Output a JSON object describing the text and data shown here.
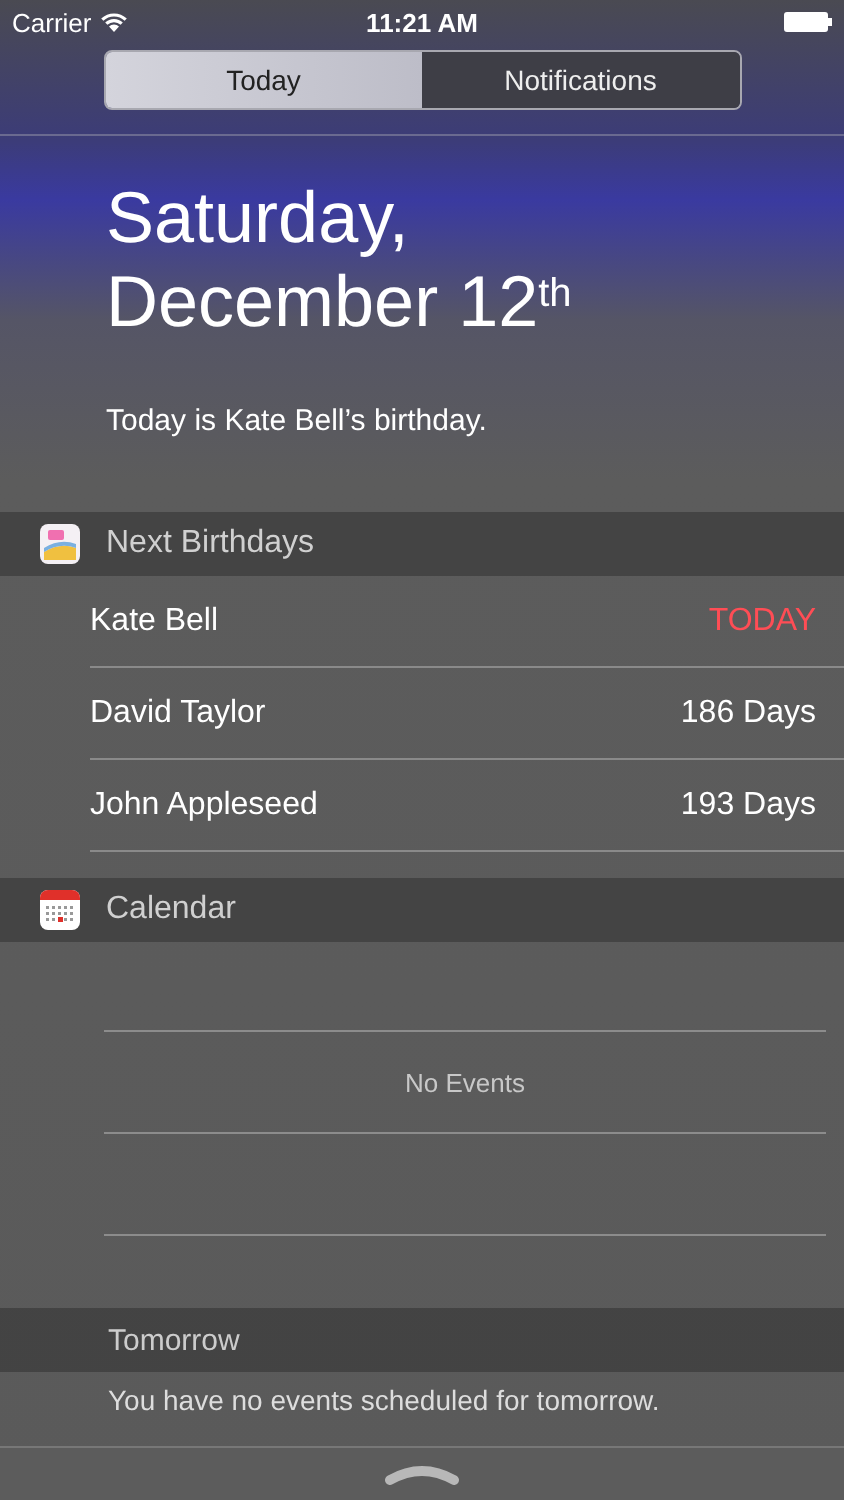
{
  "status_bar": {
    "carrier": "Carrier",
    "time": "11:21 AM"
  },
  "tabs": [
    {
      "label": "Today",
      "selected": true
    },
    {
      "label": "Notifications",
      "selected": false
    }
  ],
  "date": {
    "line_1": "Saturday,",
    "line_2": "December 12$^{th}$"
  },
  "summary": "Today is Kate Bell’s birthday.",
  "widgets": [
    {
      "kind": "birthdays",
      "title": "Next Birthdays",
      "rows": [
        {
          "name": "Kate Bell",
          "when": "TODAY",
          "today": true
        },
        {
          "name": "David Taylor",
          "when": "186 Days",
          "today": false
        },
        {
          "name": "John Appleseed",
          "when": "193 Days",
          "today": false
        }
      ]
    },
    {
      "kind": "calendar",
      "title": "Calendar",
      "message": "No Events",
      "subheader": "Tomorrow",
      "note": "You have no events scheduled for tomorrow."
    }
  ]
}
